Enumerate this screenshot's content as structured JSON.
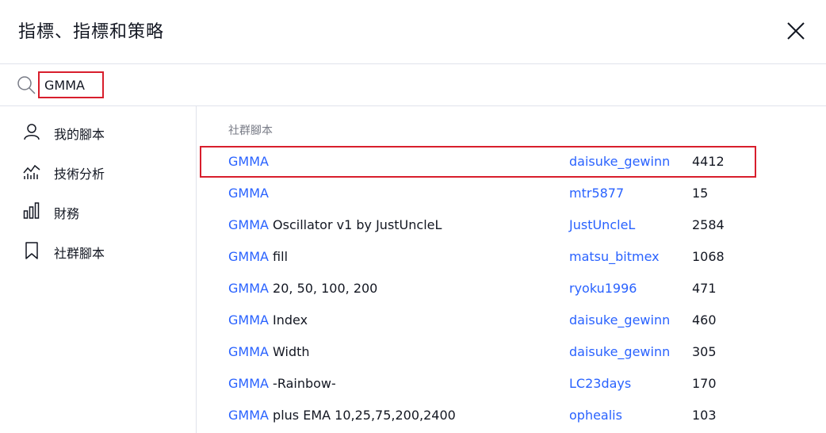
{
  "dialog": {
    "title": "指標、指標和策略"
  },
  "search": {
    "value": "GMMA",
    "placeholder": ""
  },
  "sidebar": {
    "items": [
      {
        "label": "我的腳本",
        "icon": "user-icon"
      },
      {
        "label": "技術分析",
        "icon": "chart-line-icon"
      },
      {
        "label": "財務",
        "icon": "bar-chart-icon"
      },
      {
        "label": "社群腳本",
        "icon": "bookmark-icon"
      }
    ]
  },
  "main": {
    "section_title": "社群腳本",
    "results": [
      {
        "match": "GMMA",
        "rest": "",
        "author": "daisuke_gewinn",
        "likes": "4412",
        "selected": true
      },
      {
        "match": "GMMA",
        "rest": "",
        "author": "mtr5877",
        "likes": "15"
      },
      {
        "match": "GMMA",
        "rest": " Oscillator v1 by JustUncleL",
        "author": "JustUncleL",
        "likes": "2584"
      },
      {
        "match": "GMMA",
        "rest": " fill",
        "author": "matsu_bitmex",
        "likes": "1068"
      },
      {
        "match": "GMMA",
        "rest": " 20, 50, 100, 200",
        "author": "ryoku1996",
        "likes": "471"
      },
      {
        "match": "GMMA",
        "rest": " Index",
        "author": "daisuke_gewinn",
        "likes": "460"
      },
      {
        "match": "GMMA",
        "rest": " Width",
        "author": "daisuke_gewinn",
        "likes": "305"
      },
      {
        "match": "GMMA",
        "rest": " -Rainbow-",
        "author": "LC23days",
        "likes": "170"
      },
      {
        "match": "GMMA",
        "rest": " plus EMA 10,25,75,200,2400",
        "author": "ophealis",
        "likes": "103"
      }
    ]
  },
  "colors": {
    "link": "#2962ff",
    "highlight_border": "#d81e2c",
    "divider": "#e0e3eb"
  }
}
